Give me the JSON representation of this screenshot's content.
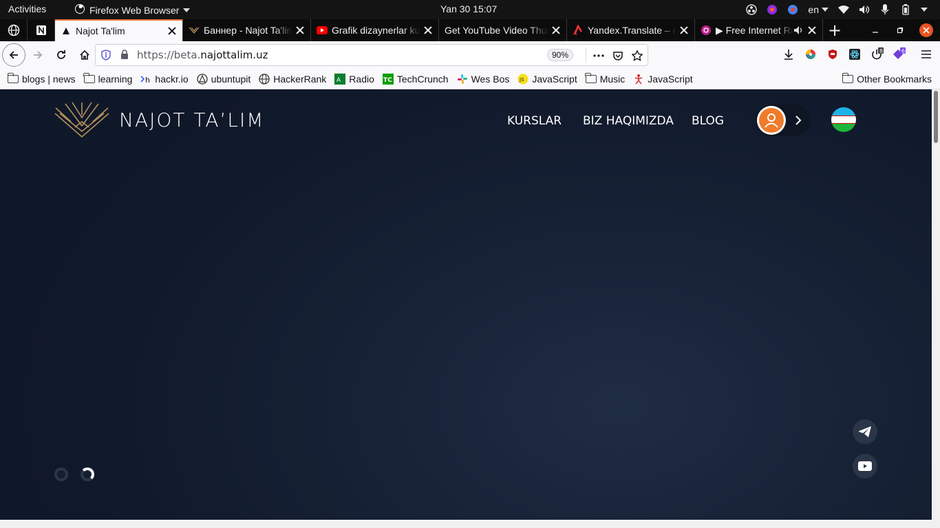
{
  "topbar": {
    "activities": "Activities",
    "app_name": "Firefox Web Browser",
    "clock": "Yan 30  15:07",
    "lang": "en"
  },
  "tabs": [
    {
      "title": "Najot Ta'lim",
      "active": true,
      "favicon": "najot-triangle-icon"
    },
    {
      "title": "Баннер - Najot Ta'lim",
      "active": false,
      "favicon": "najot-logo-icon"
    },
    {
      "title": "Grafik dizaynerlar kursi",
      "active": false,
      "favicon": "youtube-icon"
    },
    {
      "title": "Get YouTube Video Thumbnail",
      "active": false,
      "favicon": "none"
    },
    {
      "title": "Yandex.Translate – dictionary",
      "active": false,
      "favicon": "yandex-translate-icon"
    },
    {
      "title": "▶ Free Internet Radio",
      "active": false,
      "favicon": "radio-icon",
      "audio": true
    }
  ],
  "navbar": {
    "url_prefix": "https://beta.",
    "url_domain": "najottalim.uz",
    "zoom": "90%",
    "extension_badges": {
      "power": "8",
      "purple": "6"
    }
  },
  "bookmarks": [
    {
      "label": "blogs | news",
      "icon": "folder-icon"
    },
    {
      "label": "learning",
      "icon": "folder-icon"
    },
    {
      "label": "hackr.io",
      "icon": "hackr-icon"
    },
    {
      "label": "ubuntupit",
      "icon": "ubuntupit-icon"
    },
    {
      "label": "HackerRank",
      "icon": "globe-icon"
    },
    {
      "label": "Radio",
      "icon": "radio-green-icon"
    },
    {
      "label": "TechCrunch",
      "icon": "techcrunch-icon"
    },
    {
      "label": "Wes Bos",
      "icon": "slack-icon"
    },
    {
      "label": "JavaScript",
      "icon": "js-icon"
    },
    {
      "label": "Music",
      "icon": "folder-icon"
    },
    {
      "label": "JavaScript",
      "icon": "figure-icon"
    }
  ],
  "other_bookmarks": "Other Bookmarks",
  "site": {
    "brand": "NAJOT TA’LIM",
    "nav": [
      "KURSLAR",
      "BIZ HAQIMIZDA",
      "BLOG"
    ],
    "colors": {
      "background": "#131d30",
      "accent": "#f07b2a",
      "logo_gold": "#b8915c"
    }
  }
}
